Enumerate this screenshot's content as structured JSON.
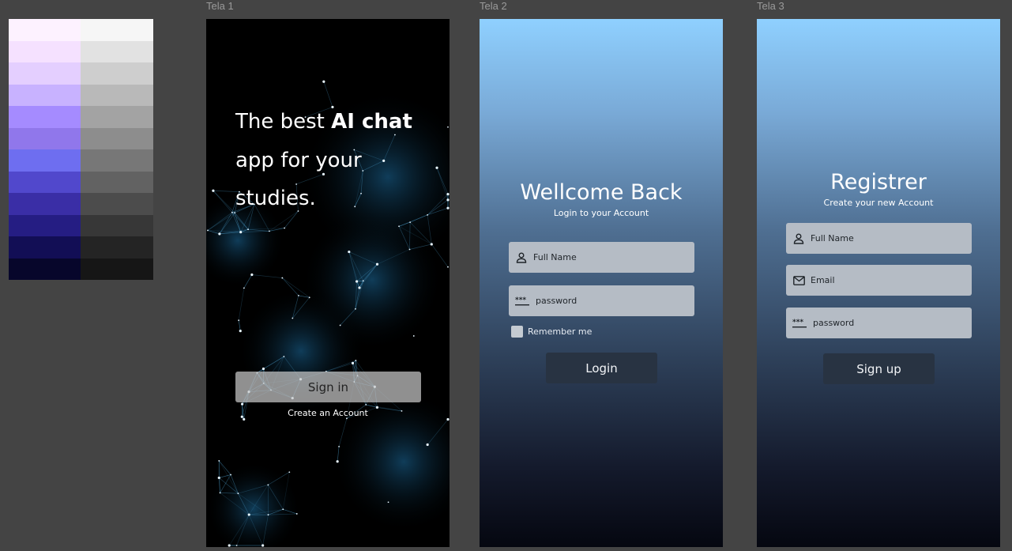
{
  "palette": {
    "purple": [
      "#fdf2ff",
      "#f5e1ff",
      "#e4cfff",
      "#c8b2ff",
      "#a58bff",
      "#9077eb",
      "#6e6ef0",
      "#5148cc",
      "#3a2ea6",
      "#251d83",
      "#120e55",
      "#07062b"
    ],
    "gray": [
      "#f6f6f6",
      "#e2e2e2",
      "#cecece",
      "#b9b9b9",
      "#a3a3a3",
      "#8d8d8d",
      "#777777",
      "#626262",
      "#4c4c4c",
      "#373737",
      "#242424",
      "#161616"
    ]
  },
  "tela1": {
    "frame_label": "Tela 1",
    "hero_prefix": "The best ",
    "hero_bold": "AI chat",
    "hero_rest": "app for your studies.",
    "signin_label": "Sign in",
    "create_account": "Create an Account"
  },
  "tela2": {
    "frame_label": "Tela 2",
    "title": "Wellcome Back",
    "subtitle": "Login to your Account",
    "full_name_placeholder": "Full Name",
    "password_placeholder": "password",
    "remember_label": "Remember me",
    "login_label": "Login",
    "icons": {
      "full_name": "person-icon",
      "password": "password-dots-icon",
      "remember": "checkbox"
    }
  },
  "tela3": {
    "frame_label": "Tela 3",
    "title": "Registrer",
    "subtitle": "Create your new Account",
    "full_name_placeholder": "Full Name",
    "email_placeholder": "Email",
    "password_placeholder": "password",
    "signup_label": "Sign up",
    "icons": {
      "full_name": "person-icon",
      "email": "mail-icon",
      "password": "password-dots-icon"
    }
  },
  "colors": {
    "canvas": "#444444",
    "gradient_top": "#8fd0ff",
    "gradient_bottom": "#050710",
    "field_bg": "#b5bcc5",
    "dark_button": "#283342"
  }
}
